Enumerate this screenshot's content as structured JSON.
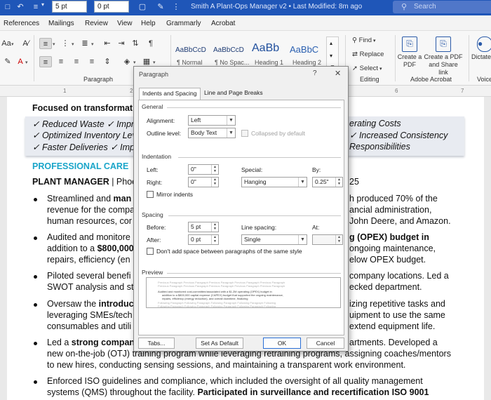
{
  "titlebar": {
    "font_size_value": "5 pt",
    "spacing_value": "0 pt",
    "document_title": "Smith A Plant-Ops Manager v2 • Last Modified: 8m ago",
    "search_placeholder": "Search"
  },
  "menu": [
    "References",
    "Mailings",
    "Review",
    "View",
    "Help",
    "Grammarly",
    "Acrobat"
  ],
  "ribbon": {
    "paragraph_group": "Paragraph",
    "styles_group_label_hidden": "",
    "styles": [
      {
        "preview": "AaBbCcD",
        "name": "¶ Normal"
      },
      {
        "preview": "AaBbCcD",
        "name": "¶ No Spac..."
      },
      {
        "preview": "AaBb",
        "name": "Heading 1"
      },
      {
        "preview": "AaBbC",
        "name": "Heading 2"
      }
    ],
    "find": "Find",
    "replace": "Replace",
    "select": "Select",
    "editing_group": "Editing",
    "create_pdf": "Create a PDF",
    "create_pdf_share": "Create a PDF and Share link",
    "acrobat_group": "Adobe Acrobat",
    "dictate": "Dictate",
    "voice_group": "Voice"
  },
  "ruler": [
    "1",
    "2",
    "3",
    "4",
    "5",
    "6",
    "7"
  ],
  "document": {
    "heading_partial": "Focused on transformati",
    "checks": [
      {
        "left": "✓ Reduced Waste ✓ Impr",
        "right": "erating Costs"
      },
      {
        "left": "✓ Optimized Inventory Lev",
        "right": "✓ Increased Consistency"
      },
      {
        "left": "✓ Faster Deliveries ✓ Imp",
        "right": "Responsibilities"
      }
    ],
    "section_title": "PROFESSIONAL CARE",
    "job_title": "PLANT MANAGER",
    "job_location": " | Phoe",
    "job_year": "25",
    "bullets": [
      {
        "left": [
          "Streamlined and ",
          "man"
        ],
        "right": "h produced 70% of the"
      },
      {
        "left": [
          "revenue for the compa"
        ],
        "right": "ancial administration,"
      },
      {
        "left": [
          "human resources, cor"
        ],
        "right": "John Deere, and Amazon."
      },
      {
        "left": [
          "Audited and monitore"
        ],
        "right": "g (OPEX) budget in"
      },
      {
        "left": [
          "addition to a ",
          "$800,000"
        ],
        "right": "ongoing maintenance,"
      },
      {
        "left": [
          "repairs, efficiency (en"
        ],
        "right": "elow OPEX budget."
      },
      {
        "left": [
          "Piloted several benefi"
        ],
        "right": "company locations. Led a"
      },
      {
        "left": [
          "SWOT analysis and st"
        ],
        "right": "ecked department."
      },
      {
        "left": [
          "Oversaw the ",
          "introduc"
        ],
        "right": "izing repetitive tasks and"
      },
      {
        "left": [
          "leveraging SMEs/tech"
        ],
        "right": "uipment to use the same"
      },
      {
        "left": [
          "consumables and utili"
        ],
        "right": "extend equipment life."
      },
      {
        "left": [
          "Led a ",
          "strong compan"
        ],
        "right": "artments. Developed a"
      }
    ],
    "full_lines": [
      "new on-the-job (OTJ) training program while leveraging retraining programs, assigning coaches/mentors",
      "to new hires, conducting sensing sessions, and maintaining a transparent work environment.",
      "Enforced ISO guidelines and compliance, which included the oversight of all quality management",
      "systems (QMS) throughout the facility. "
    ],
    "iso_bold": "Participated in surveillance and recertification ISO 9001"
  },
  "dialog": {
    "title": "Paragraph",
    "help": "?",
    "close": "✕",
    "tabs": [
      "Indents and Spacing",
      "Line and Page Breaks"
    ],
    "general": {
      "heading": "General",
      "alignment_label": "Alignment:",
      "alignment_value": "Left",
      "outline_label": "Outline level:",
      "outline_value": "Body Text",
      "collapsed_label": "Collapsed by default"
    },
    "indentation": {
      "heading": "Indentation",
      "left_label": "Left:",
      "left_value": "0\"",
      "right_label": "Right:",
      "right_value": "0\"",
      "special_label": "Special:",
      "special_value": "Hanging",
      "by_label": "By:",
      "by_value": "0.25\"",
      "mirror_label": "Mirror indents"
    },
    "spacing": {
      "heading": "Spacing",
      "before_label": "Before:",
      "before_value": "5 pt",
      "after_label": "After:",
      "after_value": "0 pt",
      "line_spacing_label": "Line spacing:",
      "line_spacing_value": "Single",
      "at_label": "At:",
      "at_value": "",
      "dont_add_label": "Don't add space between paragraphs of the same style"
    },
    "preview": {
      "heading": "Preview",
      "prev_line": "Previous Paragraph Previous Paragraph Previous Paragraph Previous Paragraph Previous Paragraph",
      "sample_1": "Audited and monitored cost-committee/associated with a $1.2M operating (OPEX) budget in",
      "sample_2": "addition to a $800,000 capital expense (CAPEX) budget that supported the ongoing maintenance,",
      "sample_3": "repairs, efficiency (energy reduction), and overall downtime, finalizing",
      "next_line": "Following Paragraph Following Paragraph Following Paragraph Following Paragraph Following"
    },
    "buttons": {
      "tabs": "Tabs...",
      "set_default": "Set As Default",
      "ok": "OK",
      "cancel": "Cancel"
    }
  }
}
